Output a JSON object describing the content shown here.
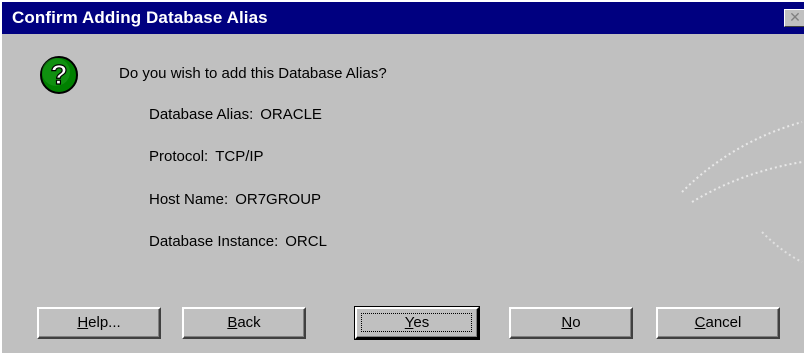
{
  "window": {
    "title": "Confirm Adding Database Alias",
    "close_glyph": "✕"
  },
  "icon": {
    "name": "question-icon",
    "glyph": "?",
    "color": "#008000"
  },
  "prompt": "Do you wish to add this Database Alias?",
  "details": [
    {
      "label": "Database Alias:",
      "value": "ORACLE"
    },
    {
      "label": "Protocol:",
      "value": "TCP/IP"
    },
    {
      "label": "Host Name:",
      "value": "OR7GROUP"
    },
    {
      "label": "Database Instance:",
      "value": "ORCL"
    }
  ],
  "buttons": {
    "help": {
      "access_key": "H",
      "rest": "elp..."
    },
    "back": {
      "access_key": "B",
      "rest": "ack"
    },
    "yes": {
      "access_key": "Y",
      "rest": "es"
    },
    "no": {
      "access_key": "N",
      "rest": "o"
    },
    "cancel": {
      "access_key": "C",
      "rest": "ancel"
    }
  },
  "colors": {
    "titlebar": "#000080",
    "face": "#c0c0c0"
  }
}
